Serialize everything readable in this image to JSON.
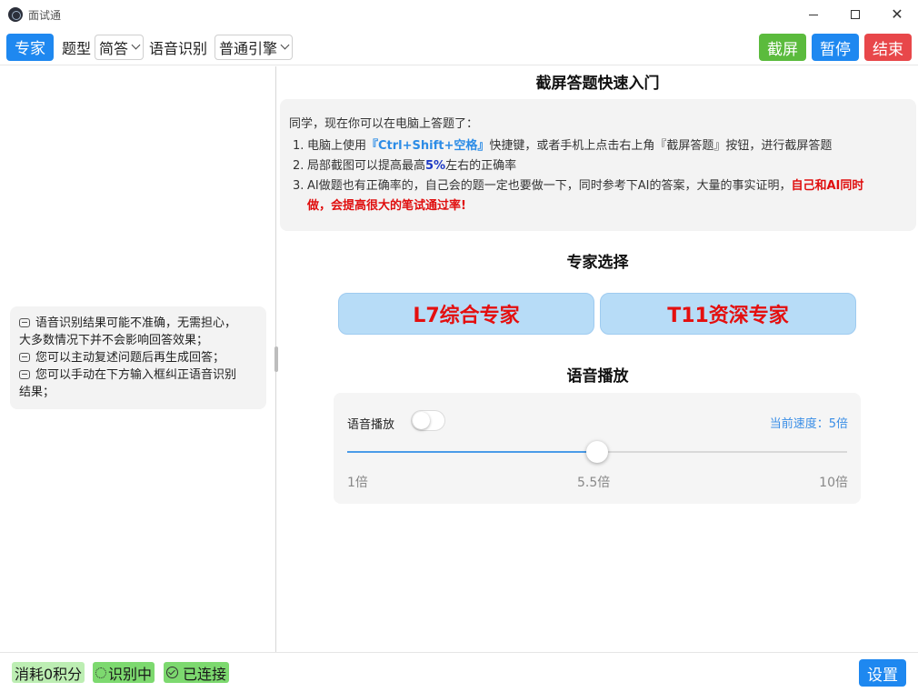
{
  "window": {
    "title": "面试通",
    "icons": {
      "logo": "app-logo-icon",
      "minimize": "minimize-icon",
      "maximize": "maximize-icon",
      "close": "close-icon"
    }
  },
  "toolbar": {
    "expert_button": "专家",
    "question_type_label": "题型",
    "question_type_value": "简答",
    "speech_recognition_label": "语音识别",
    "engine_value": "普通引擎",
    "screenshot_button": "截屏",
    "pause_button": "暂停",
    "end_button": "结束"
  },
  "tips": {
    "lines": [
      "语音识别结果可能不准确，无需担心，",
      "大多数情况下并不会影响回答效果；",
      "您可以主动复述问题后再生成回答；",
      "您可以手动在下方输入框纠正语音识别",
      "结果；"
    ],
    "icon": "chat-bubble-icon"
  },
  "guide": {
    "title": "截屏答题快速入门",
    "intro": "同学，现在你可以在电脑上答题了：",
    "item1_num": "1.",
    "item1_pre": "电脑上使用",
    "item1_hotkey": "『Ctrl+Shift+空格』",
    "item1_post": "快捷键，或者手机上点击右上角『截屏答题』按钮，进行截屏答题",
    "item2_num": "2.",
    "item2_pre": "局部截图可以提高最高",
    "item2_percent": "5%",
    "item2_post": "左右的正确率",
    "item3_num": "3.",
    "item3_text": "AI做题也有正确率的，自己会的题一定也要做一下，同时参考下AI的答案，大量的事实证明，",
    "item3_highlight_1": "自己和AI同时",
    "item3_highlight_2": "做，会提高很大的笔试通过率!"
  },
  "expert": {
    "title": "专家选择",
    "option_1": "L7综合专家",
    "option_2": "T11资深专家"
  },
  "audio": {
    "title": "语音播放",
    "toggle_label": "语音播放",
    "toggle_on": false,
    "speed_text": "当前速度：5倍",
    "slider_min": 1,
    "slider_max": 10,
    "slider_value": 5.5,
    "mark_min": "1倍",
    "mark_mid": "5.5倍",
    "mark_max": "10倍",
    "accent_color": "#4a9be8"
  },
  "status": {
    "points": "消耗0积分",
    "recognizing": "识别中",
    "connected": "已连接",
    "settings_button": "设置"
  },
  "colors": {
    "primary_blue": "#1e88f0",
    "green": "#5bbb3d",
    "red": "#e8474a",
    "badge_green": "#7dd96f",
    "expert_text": "#e40f0f"
  }
}
